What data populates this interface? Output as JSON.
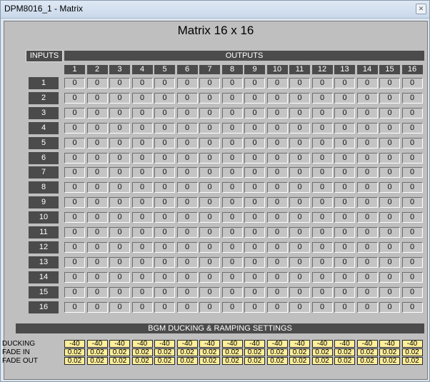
{
  "window": {
    "title": "DPM8016_1 - Matrix",
    "close_glyph": "✕"
  },
  "matrix": {
    "title": "Matrix 16 x 16",
    "inputs_label": "INPUTS",
    "outputs_label": "OUTPUTS",
    "output_headers": [
      "1",
      "2",
      "3",
      "4",
      "5",
      "6",
      "7",
      "8",
      "9",
      "10",
      "11",
      "12",
      "13",
      "14",
      "15",
      "16"
    ],
    "input_labels": [
      "1",
      "2",
      "3",
      "4",
      "5",
      "6",
      "7",
      "8",
      "9",
      "10",
      "11",
      "12",
      "13",
      "14",
      "15",
      "16"
    ],
    "cell_value": "0"
  },
  "bgm": {
    "title": "BGM DUCKING & RAMPING SETTINGS",
    "ducking_label": "DUCKING",
    "fade_in_label": "FADE IN",
    "fade_out_label": "FADE OUT",
    "ducking": [
      "-40",
      "-40",
      "-40",
      "-40",
      "-40",
      "-40",
      "-40",
      "-40",
      "-40",
      "-40",
      "-40",
      "-40",
      "-40",
      "-40",
      "-40",
      "-40"
    ],
    "fade_in": [
      "0.02",
      "0.02",
      "0.02",
      "0.02",
      "0.02",
      "0.02",
      "0.02",
      "0.02",
      "0.02",
      "0.02",
      "0.02",
      "0.02",
      "0.02",
      "0.02",
      "0.02",
      "0.02"
    ],
    "fade_out": [
      "0.02",
      "0.02",
      "0.02",
      "0.02",
      "0.02",
      "0.02",
      "0.02",
      "0.02",
      "0.02",
      "0.02",
      "0.02",
      "0.02",
      "0.02",
      "0.02",
      "0.02",
      "0.02"
    ]
  },
  "colors": {
    "panel_bg": "#bfbfbf",
    "header_dark": "#4b4b4b",
    "setting_box": "#ffef9a"
  }
}
